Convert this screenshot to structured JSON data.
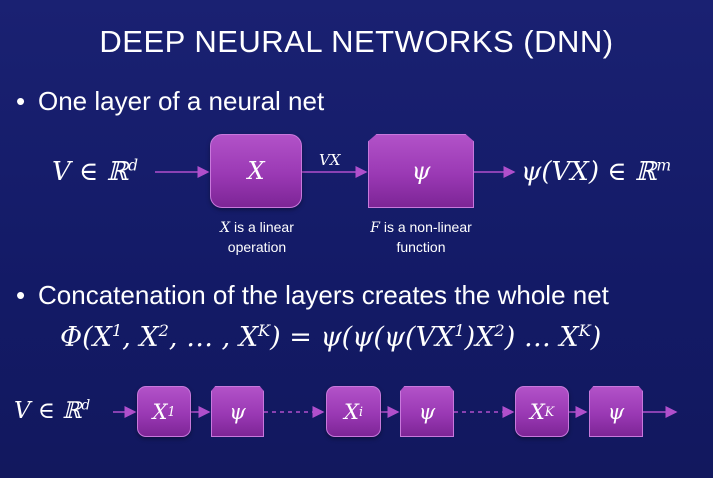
{
  "slide": {
    "title": "DEEP NEURAL NETWORKS (DNN)",
    "bullets": [
      {
        "text": "One layer of a neural net"
      },
      {
        "text": "Concatenation of the layers creates the whole net"
      }
    ]
  },
  "layer_diagram": {
    "input_math": "V ∈ ℝ",
    "input_sup": "d",
    "linear_box": "X",
    "edge_label": "VX",
    "nonlinear_box": "ψ",
    "output_math": "ψ(VX) ∈ ℝ",
    "output_sup": "m",
    "linear_caption_var": "X",
    "linear_caption_line1": " is a linear",
    "linear_caption_line2": "operation",
    "nonlinear_caption_var": "F",
    "nonlinear_caption_line1": " is a non-linear",
    "nonlinear_caption_line2": "function"
  },
  "formula": {
    "lhs_prefix": "Φ(X",
    "sup1": "1",
    "mid1": ", X",
    "sup2": "2",
    "mid2": ", … , X",
    "supK": "K",
    "mid3": ") = ψ(ψ(ψ(VX",
    "sup3": "1",
    "mid4": ")X",
    "sup4": "2",
    "mid5": ") … X",
    "sup5": "K",
    "end": ")"
  },
  "chain_diagram": {
    "input_math": "V ∈ ℝ",
    "input_sup": "d",
    "blocks": [
      {
        "base": "X",
        "sup": "1",
        "act": "ψ"
      },
      {
        "base": "X",
        "sup": "i",
        "act": "ψ"
      },
      {
        "base": "X",
        "sup": "K",
        "act": "ψ"
      }
    ]
  },
  "colors": {
    "background": "#141a6b",
    "box": "#9a39b4",
    "arrow": "#b04fcc",
    "text": "#ffffff"
  }
}
